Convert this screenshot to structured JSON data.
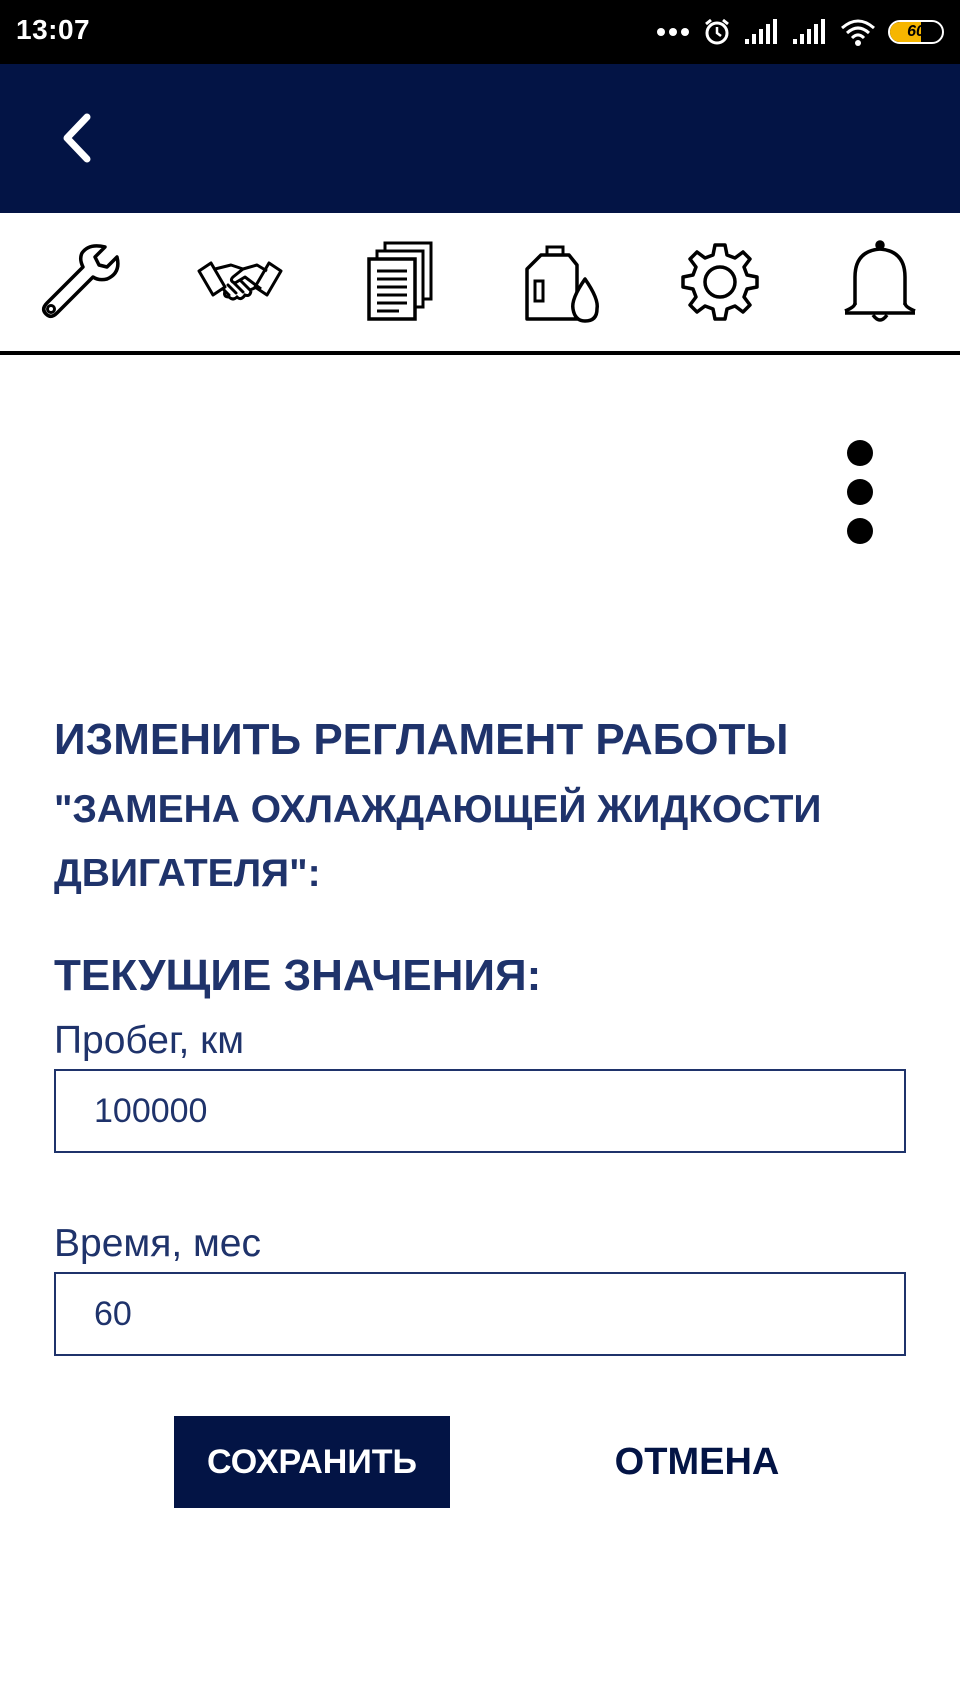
{
  "status_bar": {
    "time": "13:07",
    "battery_level": 60,
    "battery_label": "60",
    "icons": [
      "more-dots-icon",
      "alarm-icon",
      "signal-icon",
      "signal-icon",
      "wifi-icon",
      "battery-icon"
    ]
  },
  "app_bar": {
    "back_icon": "chevron-left-icon",
    "background_color": "#031445"
  },
  "tabs": [
    {
      "icon": "wrench-icon"
    },
    {
      "icon": "handshake-icon"
    },
    {
      "icon": "documents-icon"
    },
    {
      "icon": "oil-canister-icon"
    },
    {
      "icon": "gear-icon"
    },
    {
      "icon": "bell-icon"
    }
  ],
  "dialog": {
    "title": "ИЗМЕНИТЬ РЕГЛАМЕНТ РАБОТЫ",
    "subtitle": "\"ЗАМЕНА ОХЛАЖДАЮЩЕЙ ЖИДКОСТИ ДВИГАТЕЛЯ\":",
    "section_heading": "ТЕКУЩИЕ ЗНАЧЕНИЯ:",
    "fields": [
      {
        "label": "Пробег, км",
        "value": "100000"
      },
      {
        "label": "Время, мес",
        "value": "60"
      }
    ],
    "save_label": "СОХРАНИТЬ",
    "cancel_label": "ОТМЕНА"
  },
  "colors": {
    "primary": "#031445",
    "text": "#1f336b",
    "battery": "#f6b600"
  }
}
